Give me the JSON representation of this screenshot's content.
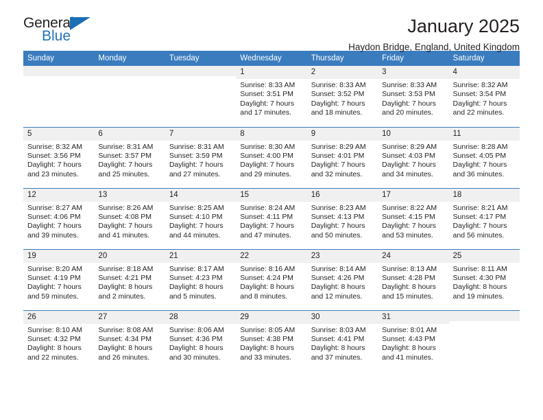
{
  "logo": {
    "line1": "General",
    "line2": "Blue",
    "accent_color": "#1b6fb5"
  },
  "header": {
    "title": "January 2025",
    "subtitle": "Haydon Bridge, England, United Kingdom"
  },
  "theme": {
    "header_bg": "#3a7cbe",
    "daynum_bg": "#f0f0f0",
    "text": "#231f20"
  },
  "weekdays": [
    "Sunday",
    "Monday",
    "Tuesday",
    "Wednesday",
    "Thursday",
    "Friday",
    "Saturday"
  ],
  "weeks": [
    [
      {
        "day": "",
        "blank": true,
        "l1": "",
        "l2": "",
        "l3": "",
        "l4": ""
      },
      {
        "day": "",
        "blank": true,
        "l1": "",
        "l2": "",
        "l3": "",
        "l4": ""
      },
      {
        "day": "",
        "blank": true,
        "l1": "",
        "l2": "",
        "l3": "",
        "l4": ""
      },
      {
        "day": "1",
        "l1": "Sunrise: 8:33 AM",
        "l2": "Sunset: 3:51 PM",
        "l3": "Daylight: 7 hours",
        "l4": "and 17 minutes."
      },
      {
        "day": "2",
        "l1": "Sunrise: 8:33 AM",
        "l2": "Sunset: 3:52 PM",
        "l3": "Daylight: 7 hours",
        "l4": "and 18 minutes."
      },
      {
        "day": "3",
        "l1": "Sunrise: 8:33 AM",
        "l2": "Sunset: 3:53 PM",
        "l3": "Daylight: 7 hours",
        "l4": "and 20 minutes."
      },
      {
        "day": "4",
        "l1": "Sunrise: 8:32 AM",
        "l2": "Sunset: 3:54 PM",
        "l3": "Daylight: 7 hours",
        "l4": "and 22 minutes."
      }
    ],
    [
      {
        "day": "5",
        "l1": "Sunrise: 8:32 AM",
        "l2": "Sunset: 3:56 PM",
        "l3": "Daylight: 7 hours",
        "l4": "and 23 minutes."
      },
      {
        "day": "6",
        "l1": "Sunrise: 8:31 AM",
        "l2": "Sunset: 3:57 PM",
        "l3": "Daylight: 7 hours",
        "l4": "and 25 minutes."
      },
      {
        "day": "7",
        "l1": "Sunrise: 8:31 AM",
        "l2": "Sunset: 3:59 PM",
        "l3": "Daylight: 7 hours",
        "l4": "and 27 minutes."
      },
      {
        "day": "8",
        "l1": "Sunrise: 8:30 AM",
        "l2": "Sunset: 4:00 PM",
        "l3": "Daylight: 7 hours",
        "l4": "and 29 minutes."
      },
      {
        "day": "9",
        "l1": "Sunrise: 8:29 AM",
        "l2": "Sunset: 4:01 PM",
        "l3": "Daylight: 7 hours",
        "l4": "and 32 minutes."
      },
      {
        "day": "10",
        "l1": "Sunrise: 8:29 AM",
        "l2": "Sunset: 4:03 PM",
        "l3": "Daylight: 7 hours",
        "l4": "and 34 minutes."
      },
      {
        "day": "11",
        "l1": "Sunrise: 8:28 AM",
        "l2": "Sunset: 4:05 PM",
        "l3": "Daylight: 7 hours",
        "l4": "and 36 minutes."
      }
    ],
    [
      {
        "day": "12",
        "l1": "Sunrise: 8:27 AM",
        "l2": "Sunset: 4:06 PM",
        "l3": "Daylight: 7 hours",
        "l4": "and 39 minutes."
      },
      {
        "day": "13",
        "l1": "Sunrise: 8:26 AM",
        "l2": "Sunset: 4:08 PM",
        "l3": "Daylight: 7 hours",
        "l4": "and 41 minutes."
      },
      {
        "day": "14",
        "l1": "Sunrise: 8:25 AM",
        "l2": "Sunset: 4:10 PM",
        "l3": "Daylight: 7 hours",
        "l4": "and 44 minutes."
      },
      {
        "day": "15",
        "l1": "Sunrise: 8:24 AM",
        "l2": "Sunset: 4:11 PM",
        "l3": "Daylight: 7 hours",
        "l4": "and 47 minutes."
      },
      {
        "day": "16",
        "l1": "Sunrise: 8:23 AM",
        "l2": "Sunset: 4:13 PM",
        "l3": "Daylight: 7 hours",
        "l4": "and 50 minutes."
      },
      {
        "day": "17",
        "l1": "Sunrise: 8:22 AM",
        "l2": "Sunset: 4:15 PM",
        "l3": "Daylight: 7 hours",
        "l4": "and 53 minutes."
      },
      {
        "day": "18",
        "l1": "Sunrise: 8:21 AM",
        "l2": "Sunset: 4:17 PM",
        "l3": "Daylight: 7 hours",
        "l4": "and 56 minutes."
      }
    ],
    [
      {
        "day": "19",
        "l1": "Sunrise: 8:20 AM",
        "l2": "Sunset: 4:19 PM",
        "l3": "Daylight: 7 hours",
        "l4": "and 59 minutes."
      },
      {
        "day": "20",
        "l1": "Sunrise: 8:18 AM",
        "l2": "Sunset: 4:21 PM",
        "l3": "Daylight: 8 hours",
        "l4": "and 2 minutes."
      },
      {
        "day": "21",
        "l1": "Sunrise: 8:17 AM",
        "l2": "Sunset: 4:23 PM",
        "l3": "Daylight: 8 hours",
        "l4": "and 5 minutes."
      },
      {
        "day": "22",
        "l1": "Sunrise: 8:16 AM",
        "l2": "Sunset: 4:24 PM",
        "l3": "Daylight: 8 hours",
        "l4": "and 8 minutes."
      },
      {
        "day": "23",
        "l1": "Sunrise: 8:14 AM",
        "l2": "Sunset: 4:26 PM",
        "l3": "Daylight: 8 hours",
        "l4": "and 12 minutes."
      },
      {
        "day": "24",
        "l1": "Sunrise: 8:13 AM",
        "l2": "Sunset: 4:28 PM",
        "l3": "Daylight: 8 hours",
        "l4": "and 15 minutes."
      },
      {
        "day": "25",
        "l1": "Sunrise: 8:11 AM",
        "l2": "Sunset: 4:30 PM",
        "l3": "Daylight: 8 hours",
        "l4": "and 19 minutes."
      }
    ],
    [
      {
        "day": "26",
        "l1": "Sunrise: 8:10 AM",
        "l2": "Sunset: 4:32 PM",
        "l3": "Daylight: 8 hours",
        "l4": "and 22 minutes."
      },
      {
        "day": "27",
        "l1": "Sunrise: 8:08 AM",
        "l2": "Sunset: 4:34 PM",
        "l3": "Daylight: 8 hours",
        "l4": "and 26 minutes."
      },
      {
        "day": "28",
        "l1": "Sunrise: 8:06 AM",
        "l2": "Sunset: 4:36 PM",
        "l3": "Daylight: 8 hours",
        "l4": "and 30 minutes."
      },
      {
        "day": "29",
        "l1": "Sunrise: 8:05 AM",
        "l2": "Sunset: 4:38 PM",
        "l3": "Daylight: 8 hours",
        "l4": "and 33 minutes."
      },
      {
        "day": "30",
        "l1": "Sunrise: 8:03 AM",
        "l2": "Sunset: 4:41 PM",
        "l3": "Daylight: 8 hours",
        "l4": "and 37 minutes."
      },
      {
        "day": "31",
        "l1": "Sunrise: 8:01 AM",
        "l2": "Sunset: 4:43 PM",
        "l3": "Daylight: 8 hours",
        "l4": "and 41 minutes."
      },
      {
        "day": "",
        "blank": true,
        "l1": "",
        "l2": "",
        "l3": "",
        "l4": ""
      }
    ]
  ]
}
